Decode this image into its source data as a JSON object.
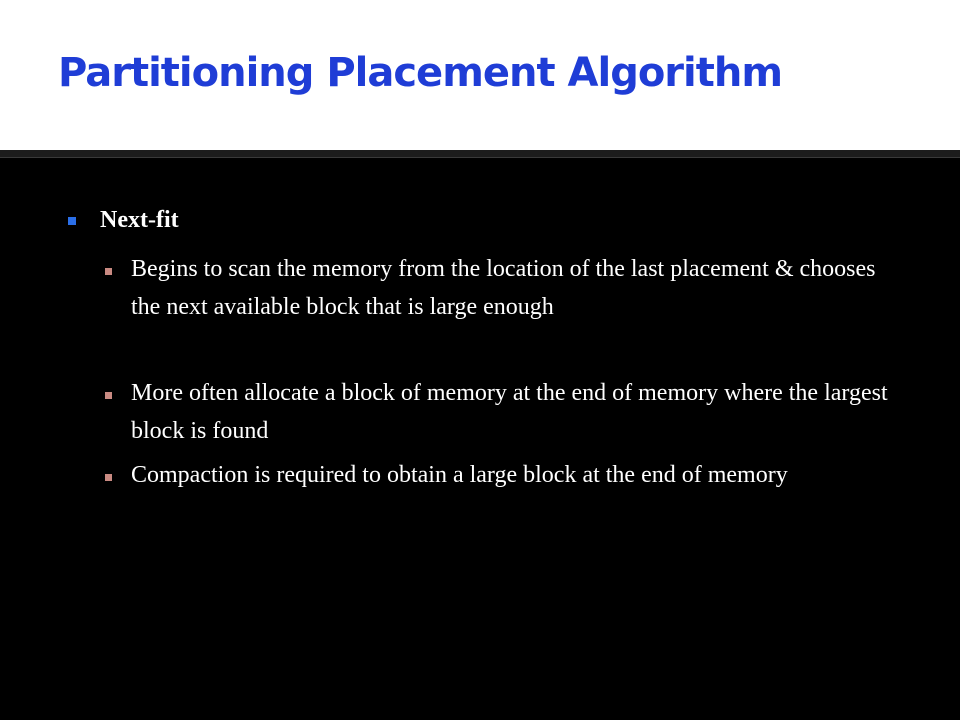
{
  "slide": {
    "title": "Partitioning Placement Algorithm",
    "heading": "Next-fit",
    "bullets": [
      "Begins to scan the memory from the location of the last placement & chooses the next available block that is large enough",
      "More often allocate a block of memory at the end of memory where the largest block is found",
      "Compaction is required to obtain a large block at the end of memory"
    ]
  },
  "colors": {
    "title": "#1f3dd6",
    "background": "#000000",
    "title_band": "#ffffff",
    "level1_bullet": "#2b6fe8",
    "level2_bullet": "#c98a82"
  }
}
